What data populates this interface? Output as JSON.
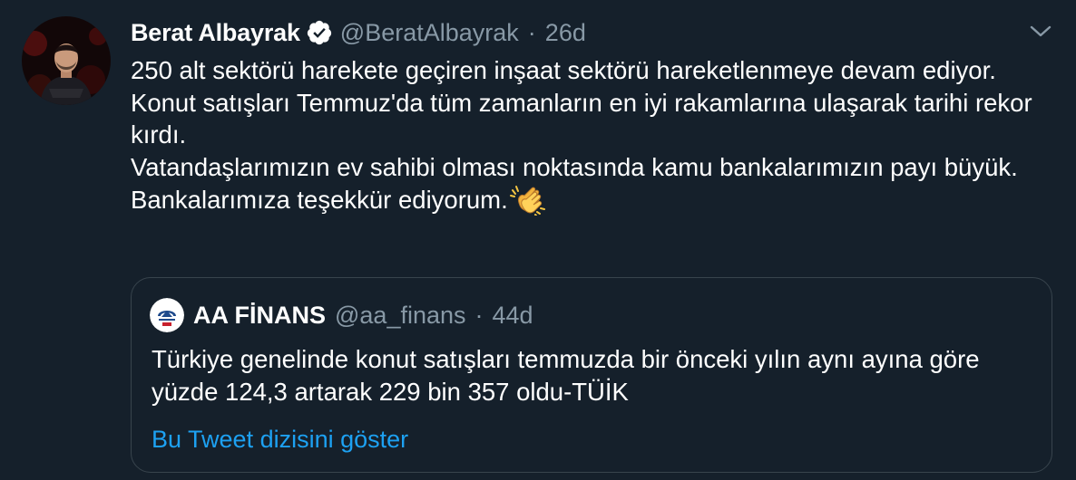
{
  "tweet": {
    "author_name": "Berat Albayrak",
    "author_handle": "@BeratAlbayrak",
    "separator": "·",
    "time": "26d",
    "lines": [
      "250 alt sektörü harekete geçiren inşaat sektörü hareketlenmeye devam ediyor.",
      "Konut satışları Temmuz'da tüm zamanların en iyi rakamlarına ulaşarak tarihi rekor kırdı.",
      "Vatandaşlarımızın ev sahibi olması noktasında kamu bankalarımızın payı büyük. Bankalarımıza teşekkür ediyorum."
    ],
    "emoji": "clapping-hands-emoji",
    "verified_icon": "verified-badge-icon",
    "menu_icon": "chevron-down-icon"
  },
  "quoted": {
    "author_name": "AA FİNANS",
    "author_handle": "@aa_finans",
    "separator": "·",
    "time": "44d",
    "text": "Türkiye genelinde konut satışları temmuzda bir önceki yılın aynı ayına göre yüzde 124,3 artarak 229 bin 357 oldu-TÜİK",
    "show_thread_label": "Bu Tweet dizisini göster"
  },
  "colors": {
    "background": "#15202b",
    "primary_text": "#ffffff",
    "secondary_text": "#8899a6",
    "link": "#1da1f2",
    "verified": "#ffffff",
    "border": "#38444d"
  }
}
